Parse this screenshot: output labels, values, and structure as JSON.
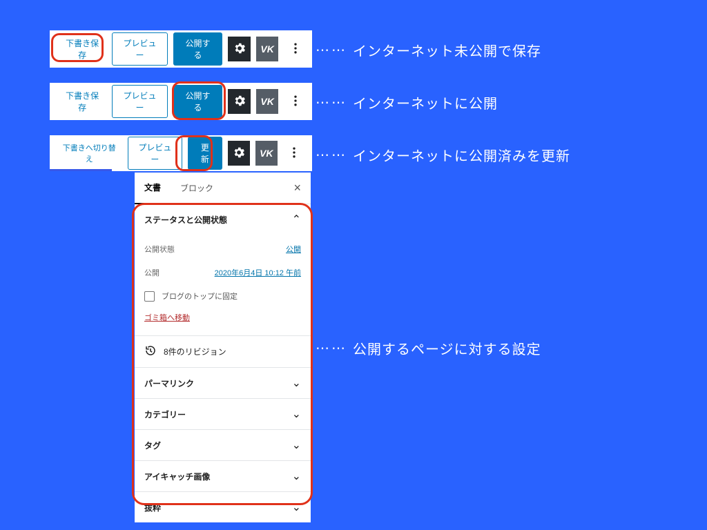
{
  "toolbar1": {
    "draft": "下書き保存",
    "preview": "プレビュー",
    "publish": "公開する"
  },
  "toolbar2": {
    "draft": "下書き保存",
    "preview": "プレビュー",
    "publish": "公開する"
  },
  "toolbar3": {
    "switch_draft": "下書きへ切り替え",
    "preview": "プレビュー",
    "update": "更新"
  },
  "tabs": {
    "doc": "文書",
    "block": "ブロック"
  },
  "sidebar": {
    "status_title": "ステータスと公開状態",
    "visibility_label": "公開状態",
    "visibility_value": "公開",
    "publish_label": "公開",
    "publish_date": "2020年6月4日 10:12 午前",
    "sticky_label": "ブログのトップに固定",
    "trash": "ゴミ箱へ移動",
    "revisions": "8件のリビジョン",
    "permalink": "パーマリンク",
    "categories": "カテゴリー",
    "tags": "タグ",
    "featured": "アイキャッチ画像",
    "excerpt": "抜粋"
  },
  "callouts": {
    "a": "インターネット未公開で保存",
    "b": "インターネットに公開",
    "c": "インターネットに公開済みを更新",
    "d": "公開するページに対する設定"
  }
}
